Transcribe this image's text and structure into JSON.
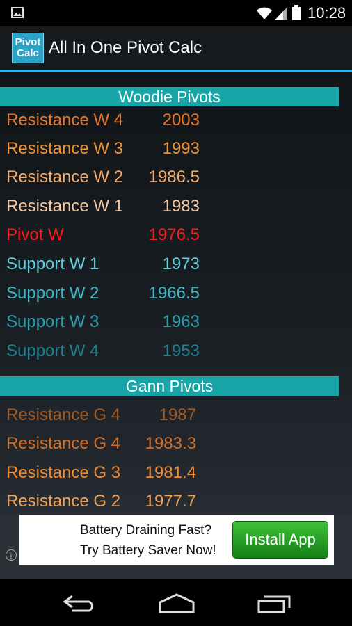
{
  "status_bar": {
    "time": "10:28"
  },
  "app": {
    "logo_line1": "Pivot",
    "logo_line2": "Calc",
    "title": "All In One Pivot Calc"
  },
  "sections": [
    {
      "title": "Woodie Pivots",
      "rows": [
        {
          "label": "Resistance W 4",
          "value": "2003",
          "color": "#e8762a"
        },
        {
          "label": "Resistance W 3",
          "value": "1993",
          "color": "#f0932f"
        },
        {
          "label": "Resistance W 2",
          "value": "1986.5",
          "color": "#f5a868"
        },
        {
          "label": "Resistance W 1",
          "value": "1983",
          "color": "#f5c7a0"
        },
        {
          "label": "Pivot W",
          "value": "1976.5",
          "color": "#ff1a1a"
        },
        {
          "label": "Support W 1",
          "value": "1973",
          "color": "#5fd0e0"
        },
        {
          "label": "Support W 2",
          "value": "1966.5",
          "color": "#3ab8c8"
        },
        {
          "label": "Support W 3",
          "value": "1963",
          "color": "#2b9fb0"
        },
        {
          "label": "Support W 4",
          "value": "1953",
          "color": "#1f7f8e"
        }
      ]
    },
    {
      "title": "Gann Pivots",
      "rows": [
        {
          "label": "Resistance G 4",
          "value": "1987",
          "color": "#a35a22"
        },
        {
          "label": "Resistance G 4",
          "value": "1983.3",
          "color": "#d36e24"
        },
        {
          "label": "Resistance G 3",
          "value": "1981.4",
          "color": "#f08a30"
        },
        {
          "label": "Resistance G 2",
          "value": "1977.7",
          "color": "#f5a050"
        }
      ]
    }
  ],
  "ad": {
    "line1": "Battery Draining Fast?",
    "line2": "Try Battery Saver Now!",
    "button": "Install App"
  }
}
